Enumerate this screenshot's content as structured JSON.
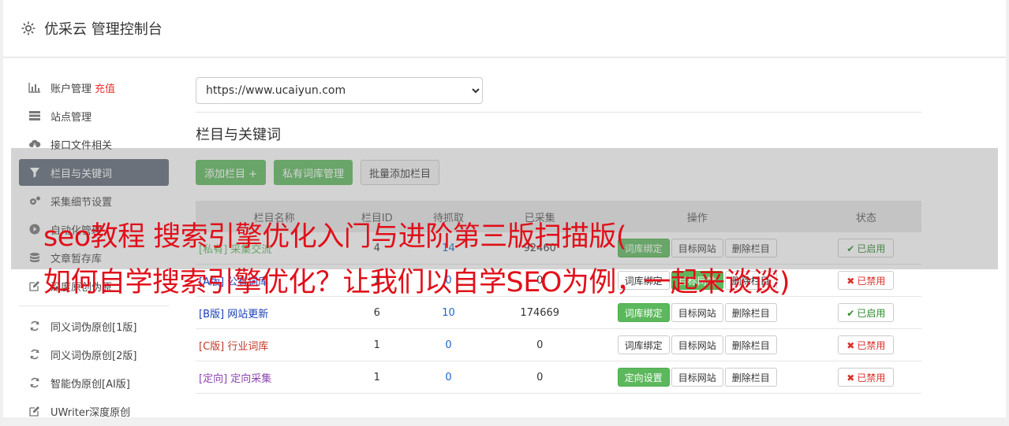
{
  "header": {
    "title": "优采云 管理控制台"
  },
  "sidebar": {
    "items": [
      {
        "label": "账户管理",
        "extra": "充值",
        "icon": "bar-chart-icon"
      },
      {
        "label": "站点管理",
        "icon": "server-icon"
      },
      {
        "label": "接口文件相关",
        "icon": "cloud-download-icon"
      },
      {
        "label": "栏目与关键词",
        "icon": "filter-icon",
        "active": true
      },
      {
        "label": "采集细节设置",
        "icon": "cogs-icon"
      },
      {
        "label": "自动化管理",
        "icon": "play-circle-icon"
      },
      {
        "label": "文章暂存库",
        "icon": "database-icon"
      },
      {
        "label": "深度原创伪原",
        "icon": "edit-icon"
      }
    ],
    "items2": [
      {
        "label": "同义词伪原创[1版]",
        "icon": "refresh-icon"
      },
      {
        "label": "同义词伪原创[2版]",
        "icon": "refresh-icon"
      },
      {
        "label": "智能伪原创[AI版]",
        "icon": "refresh-icon"
      },
      {
        "label": "UWriter深度原创",
        "icon": "edit-icon"
      }
    ]
  },
  "main": {
    "site_select": "https://www.ucaiyun.com",
    "section_title": "栏目与关键词",
    "buttons": {
      "add": "添加栏目 +",
      "private": "私有词库管理",
      "batch": "批量添加栏目"
    },
    "table": {
      "headers": [
        "栏目名称",
        "栏目ID",
        "待抓取",
        "已采集",
        "操作",
        "状态"
      ],
      "rows": [
        {
          "tag": "[私有]",
          "name": "采集交流",
          "id": "4",
          "pending": "14",
          "collected": "92460",
          "op1": "词库绑定",
          "op1_green": true,
          "status": "已启用",
          "on": true,
          "cls": "c-private"
        },
        {
          "tag": "[A版]",
          "name": "公有词库",
          "id": "1",
          "pending": "0",
          "collected": "0",
          "op1": "词库绑定",
          "op1_green": false,
          "op2_green": true,
          "status": "已禁用",
          "on": false,
          "cls": "c-b"
        },
        {
          "tag": "[B版]",
          "name": "网站更新",
          "id": "6",
          "pending": "10",
          "collected": "174669",
          "op1": "词库绑定",
          "op1_green": true,
          "status": "已启用",
          "on": true,
          "cls": "c-b"
        },
        {
          "tag": "[C版]",
          "name": "行业词库",
          "id": "1",
          "pending": "0",
          "collected": "0",
          "op1": "词库绑定",
          "op1_green": false,
          "status": "已禁用",
          "on": false,
          "cls": "c-c"
        },
        {
          "tag": "[定向]",
          "name": "定向采集",
          "id": "1",
          "pending": "0",
          "collected": "0",
          "op1": "定向设置",
          "op1_green": true,
          "status": "已禁用",
          "on": false,
          "cls": "c-target"
        }
      ],
      "op2": "目标网站",
      "op3": "删除栏目"
    }
  },
  "overlay": {
    "line1": "seo教程 搜索引擎优化入门与进阶第三版扫描版(",
    "line2": "如何自学搜索引擎优化？让我们以自学SEO为例，一起来谈谈)"
  },
  "colors": {
    "accent_green": "#5cb85c",
    "active_nav": "#5f6977",
    "ad_red": "#e0101a"
  }
}
